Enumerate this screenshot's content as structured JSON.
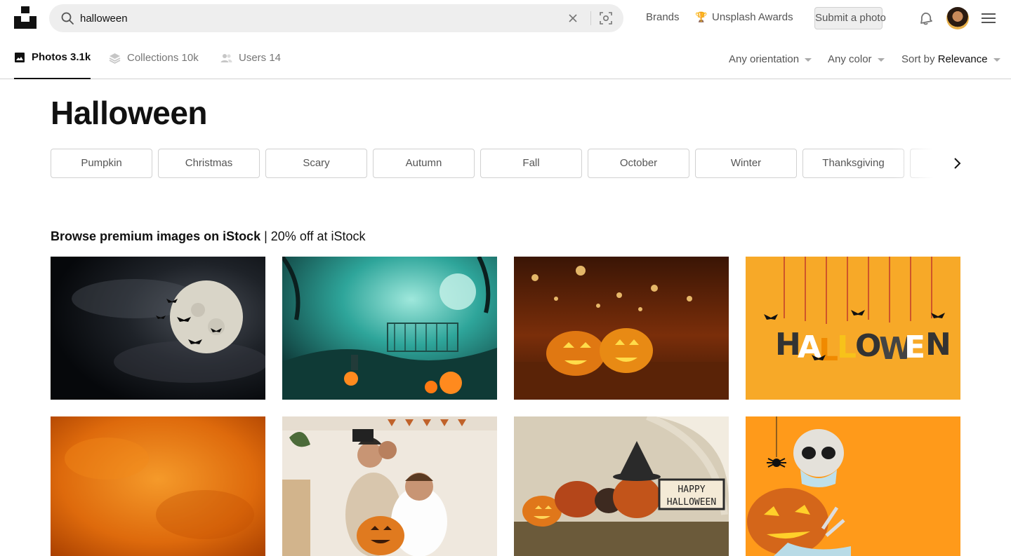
{
  "search": {
    "value": "halloween"
  },
  "header": {
    "brands_label": "Brands",
    "awards_label": "Unsplash Awards",
    "submit_label": "Submit a photo"
  },
  "tabs": [
    {
      "label": "Photos",
      "count": "3.1k",
      "icon": "image-icon",
      "active": true
    },
    {
      "label": "Collections",
      "count": "10k",
      "icon": "layers-icon",
      "active": false
    },
    {
      "label": "Users",
      "count": "14",
      "icon": "users-icon",
      "active": false
    }
  ],
  "filters": {
    "orientation": "Any orientation",
    "color": "Any color",
    "sort_prefix": "Sort by",
    "sort_value": "Relevance"
  },
  "page_title": "Halloween",
  "related_tags": [
    "Pumpkin",
    "Christmas",
    "Scary",
    "Autumn",
    "Fall",
    "October",
    "Winter",
    "Thanksgiving"
  ],
  "istock": {
    "heading_bold": "Browse premium images on iStock",
    "heading_rest": "| 20% off at iStock"
  },
  "photos": [
    {
      "name": "photo-full-moon-bats",
      "colors": [
        "#0b0f14",
        "#3a3f46",
        "#d8d4c8"
      ]
    },
    {
      "name": "photo-spooky-cemetery",
      "colors": [
        "#0e3d3a",
        "#2ea59a",
        "#ff8a1e"
      ]
    },
    {
      "name": "photo-pumpkins-forest",
      "colors": [
        "#2a0f04",
        "#8a3a0c",
        "#ffb02e"
      ]
    },
    {
      "name": "photo-halloween-letters",
      "colors": [
        "#f5a623",
        "#ffbe3b",
        "#333333"
      ]
    },
    {
      "name": "photo-orange-texture",
      "colors": [
        "#c94f00",
        "#f28a1a",
        "#a83f00"
      ]
    },
    {
      "name": "photo-family-costumes",
      "colors": [
        "#f1ece4",
        "#c8a27a",
        "#e07a1f"
      ]
    },
    {
      "name": "photo-happy-halloween-table",
      "colors": [
        "#cfc2a8",
        "#7a3a12",
        "#e8dfc9"
      ]
    },
    {
      "name": "photo-skeleton-pumpkin-mask",
      "colors": [
        "#ff9a1a",
        "#e06a0a",
        "#bfc6cc"
      ]
    }
  ]
}
